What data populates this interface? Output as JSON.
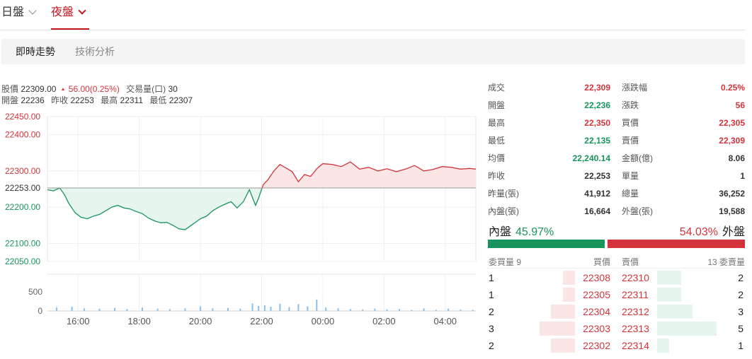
{
  "session_tabs": {
    "day": "日盤",
    "night": "夜盤"
  },
  "sub_tabs": [
    "即時走勢",
    "技術分析"
  ],
  "quote": {
    "index_label": "股價",
    "index_value": "22309.00",
    "change": "56.00(0.25%)",
    "volume_label": "交易量(口)",
    "volume_value": "30",
    "open_label": "開盤",
    "open_value": "22236",
    "prev_label": "昨收",
    "prev_value": "22253",
    "high_label": "最高",
    "high_value": "22311",
    "low_label": "最低",
    "low_value": "22307"
  },
  "colors": {
    "up": "#d3343c",
    "down": "#18955d",
    "up_fill": "#fbe5e5",
    "down_fill": "#e6f5ee",
    "accent": "#c4161c"
  },
  "chart_data": {
    "type": "line",
    "price_ticks": [
      "22450.00",
      "22400.00",
      "22300.00",
      "22253.00",
      "22200.00",
      "22100.00",
      "22050.00"
    ],
    "price_tick_values": [
      22450,
      22400,
      22300,
      22253,
      22200,
      22100,
      22050
    ],
    "ylim": [
      22050,
      22450
    ],
    "reference_price": 22253,
    "volume_ticks": [
      "500",
      "0"
    ],
    "volume_ylim": [
      0,
      500
    ],
    "time_ticks": [
      "16:00",
      "18:00",
      "20:00",
      "22:00",
      "00:00",
      "02:00",
      "04:00"
    ],
    "time_tick_hours": [
      1,
      3,
      5,
      7,
      9,
      11,
      13
    ],
    "xlim_hours": [
      0,
      14
    ],
    "x_hours": [
      0,
      0.2,
      0.4,
      0.55,
      0.7,
      0.9,
      1.1,
      1.3,
      1.5,
      1.7,
      1.9,
      2.1,
      2.3,
      2.5,
      2.7,
      2.9,
      3.1,
      3.3,
      3.5,
      3.7,
      3.9,
      4.1,
      4.3,
      4.5,
      4.7,
      4.9,
      5.0,
      5.2,
      5.4,
      5.6,
      5.8,
      6.0,
      6.2,
      6.4,
      6.6,
      6.8,
      6.9,
      7.05,
      7.2,
      7.4,
      7.6,
      7.8,
      8.0,
      8.2,
      8.4,
      8.6,
      8.8,
      9.0,
      9.3,
      9.6,
      9.9,
      10.2,
      10.5,
      10.8,
      11.1,
      11.4,
      11.7,
      12.0,
      12.3,
      12.6,
      12.9,
      13.2,
      13.5,
      13.8,
      14.0
    ],
    "price": [
      22248,
      22245,
      22253,
      22235,
      22210,
      22185,
      22172,
      22168,
      22175,
      22180,
      22190,
      22200,
      22205,
      22198,
      22195,
      22188,
      22182,
      22170,
      22162,
      22157,
      22158,
      22150,
      22140,
      22138,
      22150,
      22162,
      22168,
      22175,
      22190,
      22200,
      22208,
      22215,
      22198,
      22215,
      22248,
      22205,
      22225,
      22262,
      22275,
      22300,
      22318,
      22308,
      22298,
      22270,
      22290,
      22285,
      22306,
      22320,
      22318,
      22312,
      22325,
      22305,
      22310,
      22300,
      22306,
      22298,
      22305,
      22315,
      22300,
      22304,
      22312,
      22310,
      22305,
      22307,
      22305
    ],
    "volume_x_hours": [
      0.3,
      0.8,
      1.2,
      1.7,
      2.2,
      2.6,
      3.1,
      3.6,
      4.0,
      4.5,
      5.0,
      5.4,
      5.9,
      6.3,
      6.7,
      6.9,
      7.1,
      7.3,
      7.6,
      7.9,
      8.2,
      8.5,
      8.8,
      9.1,
      9.5,
      9.9,
      10.3,
      10.7,
      11.1,
      11.5,
      11.9,
      12.3,
      12.7,
      13.1,
      13.5,
      13.9
    ],
    "volume": [
      90,
      110,
      70,
      60,
      80,
      50,
      90,
      60,
      50,
      70,
      120,
      70,
      80,
      60,
      200,
      130,
      150,
      110,
      190,
      100,
      180,
      120,
      300,
      90,
      70,
      50,
      40,
      60,
      40,
      50,
      30,
      70,
      30,
      60,
      40,
      30
    ]
  },
  "stats": [
    {
      "l1": "成交",
      "v1": "22,309",
      "c1": "up",
      "l2": "漲跌幅",
      "v2": "0.25%",
      "c2": "up"
    },
    {
      "l1": "開盤",
      "v1": "22,236",
      "c1": "down",
      "l2": "漲跌",
      "v2": "56",
      "c2": "up"
    },
    {
      "l1": "最高",
      "v1": "22,350",
      "c1": "up",
      "l2": "買價",
      "v2": "22,305",
      "c2": "up"
    },
    {
      "l1": "最低",
      "v1": "22,135",
      "c1": "down",
      "l2": "賣價",
      "v2": "22,309",
      "c2": "up"
    },
    {
      "l1": "均價",
      "v1": "22,240.14",
      "c1": "down",
      "l2": "金額(億)",
      "v2": "8.06",
      "c2": "flat"
    },
    {
      "l1": "昨收",
      "v1": "22,253",
      "c1": "flat",
      "l2": "單量",
      "v2": "1",
      "c2": "flat"
    },
    {
      "l1": "昨量(張)",
      "v1": "41,912",
      "c1": "flat",
      "l2": "總量",
      "v2": "36,252",
      "c2": "flat"
    },
    {
      "l1": "內盤(張)",
      "v1": "16,664",
      "c1": "flat",
      "l2": "外盤(張)",
      "v2": "19,588",
      "c2": "flat"
    }
  ],
  "inner_outer": {
    "inner_label": "內盤",
    "inner_pct": "45.97%",
    "inner_fraction": 0.4597,
    "outer_label": "外盤",
    "outer_pct": "54.03%",
    "outer_fraction": 0.5403
  },
  "order_book": {
    "bid_vol_header": "委買量 9",
    "bid_header": "買價",
    "ask_header": "賣價",
    "ask_vol_header": "13 委賣量",
    "max_volume": 5,
    "rows": [
      {
        "bid_vol": "1",
        "bid": "22308",
        "ask": "22310",
        "ask_vol": "2",
        "bid_n": 1,
        "ask_n": 2
      },
      {
        "bid_vol": "1",
        "bid": "22305",
        "ask": "22311",
        "ask_vol": "2",
        "bid_n": 1,
        "ask_n": 2
      },
      {
        "bid_vol": "2",
        "bid": "22304",
        "ask": "22312",
        "ask_vol": "3",
        "bid_n": 2,
        "ask_n": 3
      },
      {
        "bid_vol": "3",
        "bid": "22303",
        "ask": "22313",
        "ask_vol": "5",
        "bid_n": 3,
        "ask_n": 5
      },
      {
        "bid_vol": "2",
        "bid": "22302",
        "ask": "22314",
        "ask_vol": "1",
        "bid_n": 2,
        "ask_n": 1
      }
    ]
  }
}
